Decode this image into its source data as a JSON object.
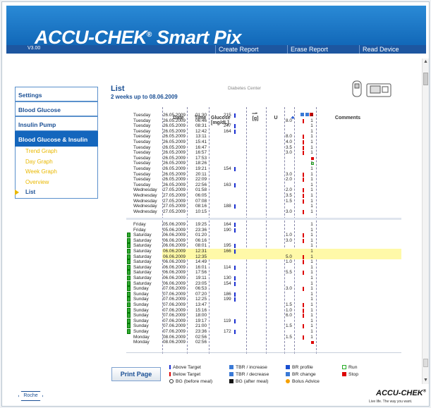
{
  "app": {
    "logo": "ACCU-CHEK",
    "logo_sup": "®",
    "logo_product": "Smart Pix",
    "version": "V3.00",
    "menu": [
      "Create Report",
      "Erase Report",
      "Read Device"
    ]
  },
  "sidebar": {
    "items": [
      {
        "label": "Settings"
      },
      {
        "label": "Blood Glucose"
      },
      {
        "label": "Insulin Pump"
      },
      {
        "label": "Blood Glucose & Insulin"
      }
    ],
    "sub": [
      "Trend Graph",
      "Day Graph",
      "Week Graph",
      "Overview",
      "List"
    ]
  },
  "page": {
    "title": "List",
    "subtitle": "2 weeks up to 08.06.2009",
    "center": "Diabetes Center"
  },
  "table": {
    "headers": {
      "date": "Date",
      "time": "Time",
      "glucose": "Glucose",
      "glucose_unit": "[mg/dL]",
      "carb_unit": "[g]",
      "u": "U",
      "comments": "Comments"
    },
    "rows_top": [
      [
        "Tuesday",
        "26.05.2009",
        "01:30",
        "215",
        "",
        "1"
      ],
      [
        "Tuesday",
        "26.05.2009",
        "06:46",
        "",
        "8.0",
        "1"
      ],
      [
        "Tuesday",
        "26.05.2009",
        "08:31",
        "247",
        "",
        "1"
      ],
      [
        "Tuesday",
        "26.05.2009",
        "12:42",
        "164",
        "",
        "1"
      ],
      [
        "Tuesday",
        "26.05.2009",
        "13:11",
        "",
        "8.0",
        "1"
      ],
      [
        "Tuesday",
        "26.05.2009",
        "15:41",
        "",
        "4.0",
        "1"
      ],
      [
        "Tuesday",
        "26.05.2009",
        "16:47",
        "",
        "3.5",
        "1"
      ],
      [
        "Tuesday",
        "26.05.2009",
        "16:57",
        "",
        "3.0",
        "1"
      ],
      [
        "Tuesday",
        "26.05.2009",
        "17:53",
        "",
        "",
        ""
      ],
      [
        "Tuesday",
        "26.05.2009",
        "18:26",
        "",
        "",
        "1"
      ],
      [
        "Tuesday",
        "26.05.2009",
        "19:21",
        "154",
        "",
        "1"
      ],
      [
        "Tuesday",
        "26.05.2009",
        "20:11",
        "",
        "3.0",
        "1"
      ],
      [
        "Tuesday",
        "26.05.2009",
        "22:09",
        "",
        "2.0",
        "1"
      ],
      [
        "Tuesday",
        "26.05.2009",
        "22:56",
        "163",
        "",
        "1"
      ],
      [
        "Wednesday",
        "27.05.2009",
        "01:58",
        "",
        "2.0",
        "1"
      ],
      [
        "Wednesday",
        "27.05.2009",
        "06:05",
        "",
        "3.5",
        "1"
      ],
      [
        "Wednesday",
        "27.05.2009",
        "07:08",
        "",
        "1.5",
        "1"
      ],
      [
        "Wednesday",
        "27.05.2009",
        "08:16",
        "188",
        "",
        "1"
      ],
      [
        "Wednesday",
        "27.05.2009",
        "10:15",
        "",
        "3.0",
        "1"
      ]
    ],
    "rows_bottom": [
      [
        "Friday",
        "05.06.2009",
        "19:25",
        "164",
        "",
        "1"
      ],
      [
        "Friday",
        "05.06.2009",
        "23:36",
        "190",
        "",
        "1"
      ],
      [
        "Saturday",
        "06.06.2009",
        "01:20",
        "",
        "1.0",
        "1"
      ],
      [
        "Saturday",
        "06.06.2009",
        "06:16",
        "",
        "3.0",
        "1"
      ],
      [
        "Saturday",
        "06.06.2009",
        "08:01",
        "195",
        "",
        "1"
      ],
      [
        "Saturday",
        "06.06.2009",
        "12:31",
        "166",
        "",
        "1"
      ],
      [
        "Saturday",
        "06.06.2009",
        "12:35",
        "",
        "5.0",
        "1"
      ],
      [
        "Saturday",
        "06.06.2009",
        "14:49",
        "",
        "1.0",
        "1"
      ],
      [
        "Saturday",
        "06.06.2009",
        "16:01",
        "114",
        "",
        "1"
      ],
      [
        "Saturday",
        "06.06.2009",
        "17:56",
        "",
        "5.5",
        "1"
      ],
      [
        "Saturday",
        "06.06.2009",
        "19:11",
        "130",
        "",
        "1"
      ],
      [
        "Saturday",
        "06.06.2009",
        "23:05",
        "154",
        "",
        "1"
      ],
      [
        "Sunday",
        "07.06.2009",
        "06:53",
        "",
        "3.0",
        "1"
      ],
      [
        "Sunday",
        "07.06.2009",
        "07:20",
        "186",
        "",
        "1"
      ],
      [
        "Sunday",
        "07.06.2009",
        "12:25",
        "199",
        "",
        "1"
      ],
      [
        "Sunday",
        "07.06.2009",
        "13:47",
        "",
        "1.5",
        "1"
      ],
      [
        "Sunday",
        "07.06.2009",
        "15:16",
        "",
        "1.0",
        "1"
      ],
      [
        "Sunday",
        "07.06.2009",
        "18:00",
        "",
        "6.0",
        "1"
      ],
      [
        "Sunday",
        "07.06.2009",
        "19:17",
        "119",
        "",
        "1"
      ],
      [
        "Sunday",
        "07.06.2009",
        "21:00",
        "",
        "1.5",
        "1"
      ],
      [
        "Sunday",
        "07.06.2009",
        "23:36",
        "172",
        "",
        "1"
      ],
      [
        "Monday",
        "08.06.2009",
        "02:56",
        "",
        "1.5",
        "1"
      ],
      [
        "Monday",
        "08.06.2009",
        "02:56",
        "",
        "",
        ""
      ]
    ]
  },
  "legend": {
    "above": "Above Target",
    "below": "Below Target",
    "bg_before": "BG (before meal)",
    "tbr_inc": "TBR / increase",
    "tbr_dec": "TBR / decrease",
    "bg_after": "BG (after meal)",
    "br_profile": "BR profile",
    "br_change": "BR change",
    "bolus": "Bolus Advice",
    "run": "Run",
    "stop": "Stop"
  },
  "print_label": "Print Page",
  "footer": {
    "roche": "Roche",
    "brand": "ACCU-CHEK",
    "brand_sup": "®",
    "tagline": "Live life. The way you want."
  },
  "colors": {
    "header": "#1268b8",
    "bar": "#1d56a0",
    "accent": "#1a4f94",
    "yellow": "#e9b800",
    "highlight": "#fff9a8"
  }
}
